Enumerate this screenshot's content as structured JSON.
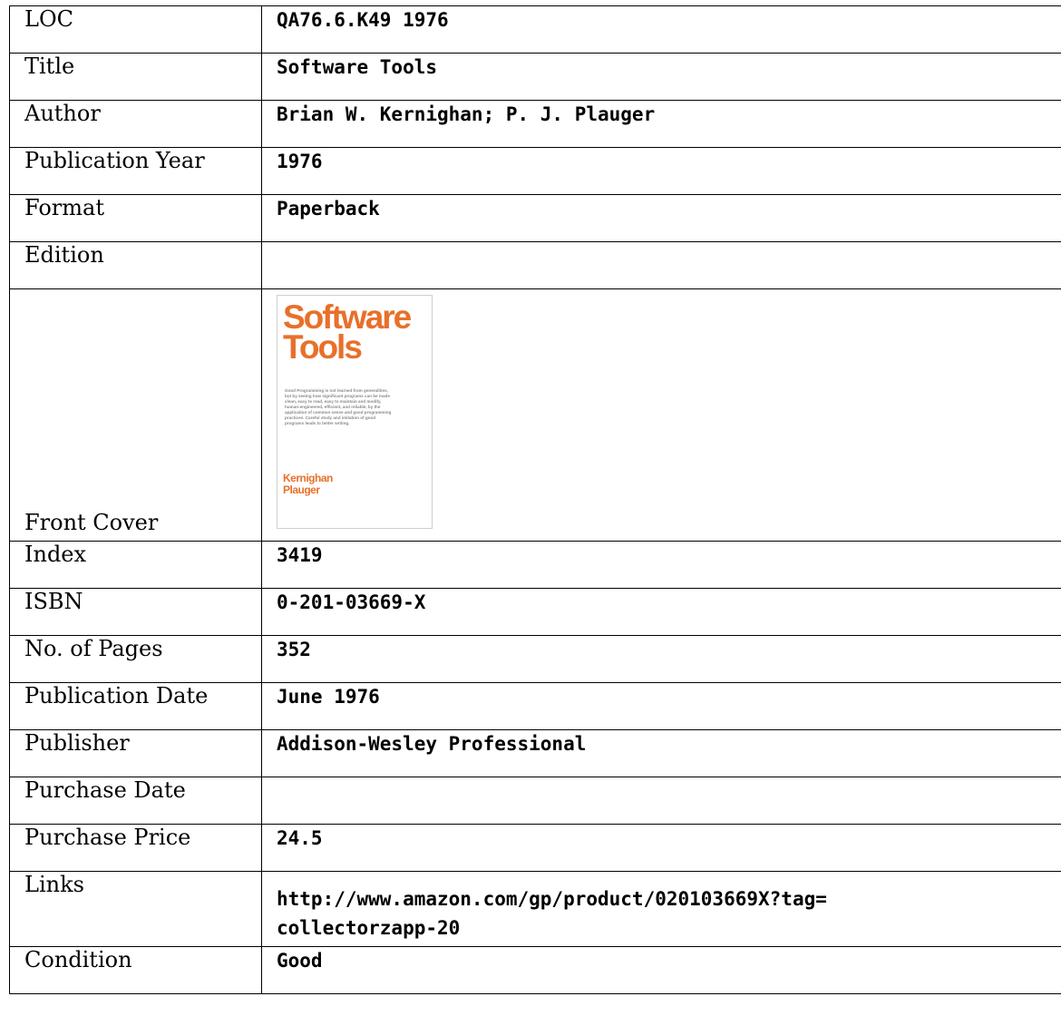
{
  "record": {
    "rows": [
      {
        "label": "LOC",
        "value": "QA76.6.K49 1976"
      },
      {
        "label": "Title",
        "value": "Software Tools"
      },
      {
        "label": "Author",
        "value": "Brian W. Kernighan; P. J. Plauger"
      },
      {
        "label": "Publication Year",
        "value": "1976"
      },
      {
        "label": "Format",
        "value": "Paperback"
      },
      {
        "label": "Edition",
        "value": ""
      },
      {
        "label": "Front Cover",
        "value": ""
      },
      {
        "label": "Index",
        "value": "3419"
      },
      {
        "label": "ISBN",
        "value": "0-201-03669-X"
      },
      {
        "label": "No. of Pages",
        "value": "352"
      },
      {
        "label": "Publication Date",
        "value": "June 1976"
      },
      {
        "label": "Publisher",
        "value": "Addison-Wesley Professional"
      },
      {
        "label": "Purchase Date",
        "value": ""
      },
      {
        "label": "Purchase Price",
        "value": "24.5"
      },
      {
        "label": "Links",
        "value_line1": "http://www.amazon.com/gp/product/020103669X?tag=",
        "value_line2": "collectorzapp-20"
      },
      {
        "label": "Condition",
        "value": "Good"
      }
    ]
  },
  "cover": {
    "title_line1": "Software",
    "title_line2": "Tools",
    "blurb": "Good Programming is not learned from generalities, but by seeing how significant programs can be made clean, easy to read, easy to maintain and modify, human-engineered, efficient, and reliable, by the application of common sense and good programming practices. Careful study and imitation of good programs leads to better writing.",
    "author1": "Kernighan",
    "author2": "Plauger",
    "accent_color": "#e8702a"
  }
}
